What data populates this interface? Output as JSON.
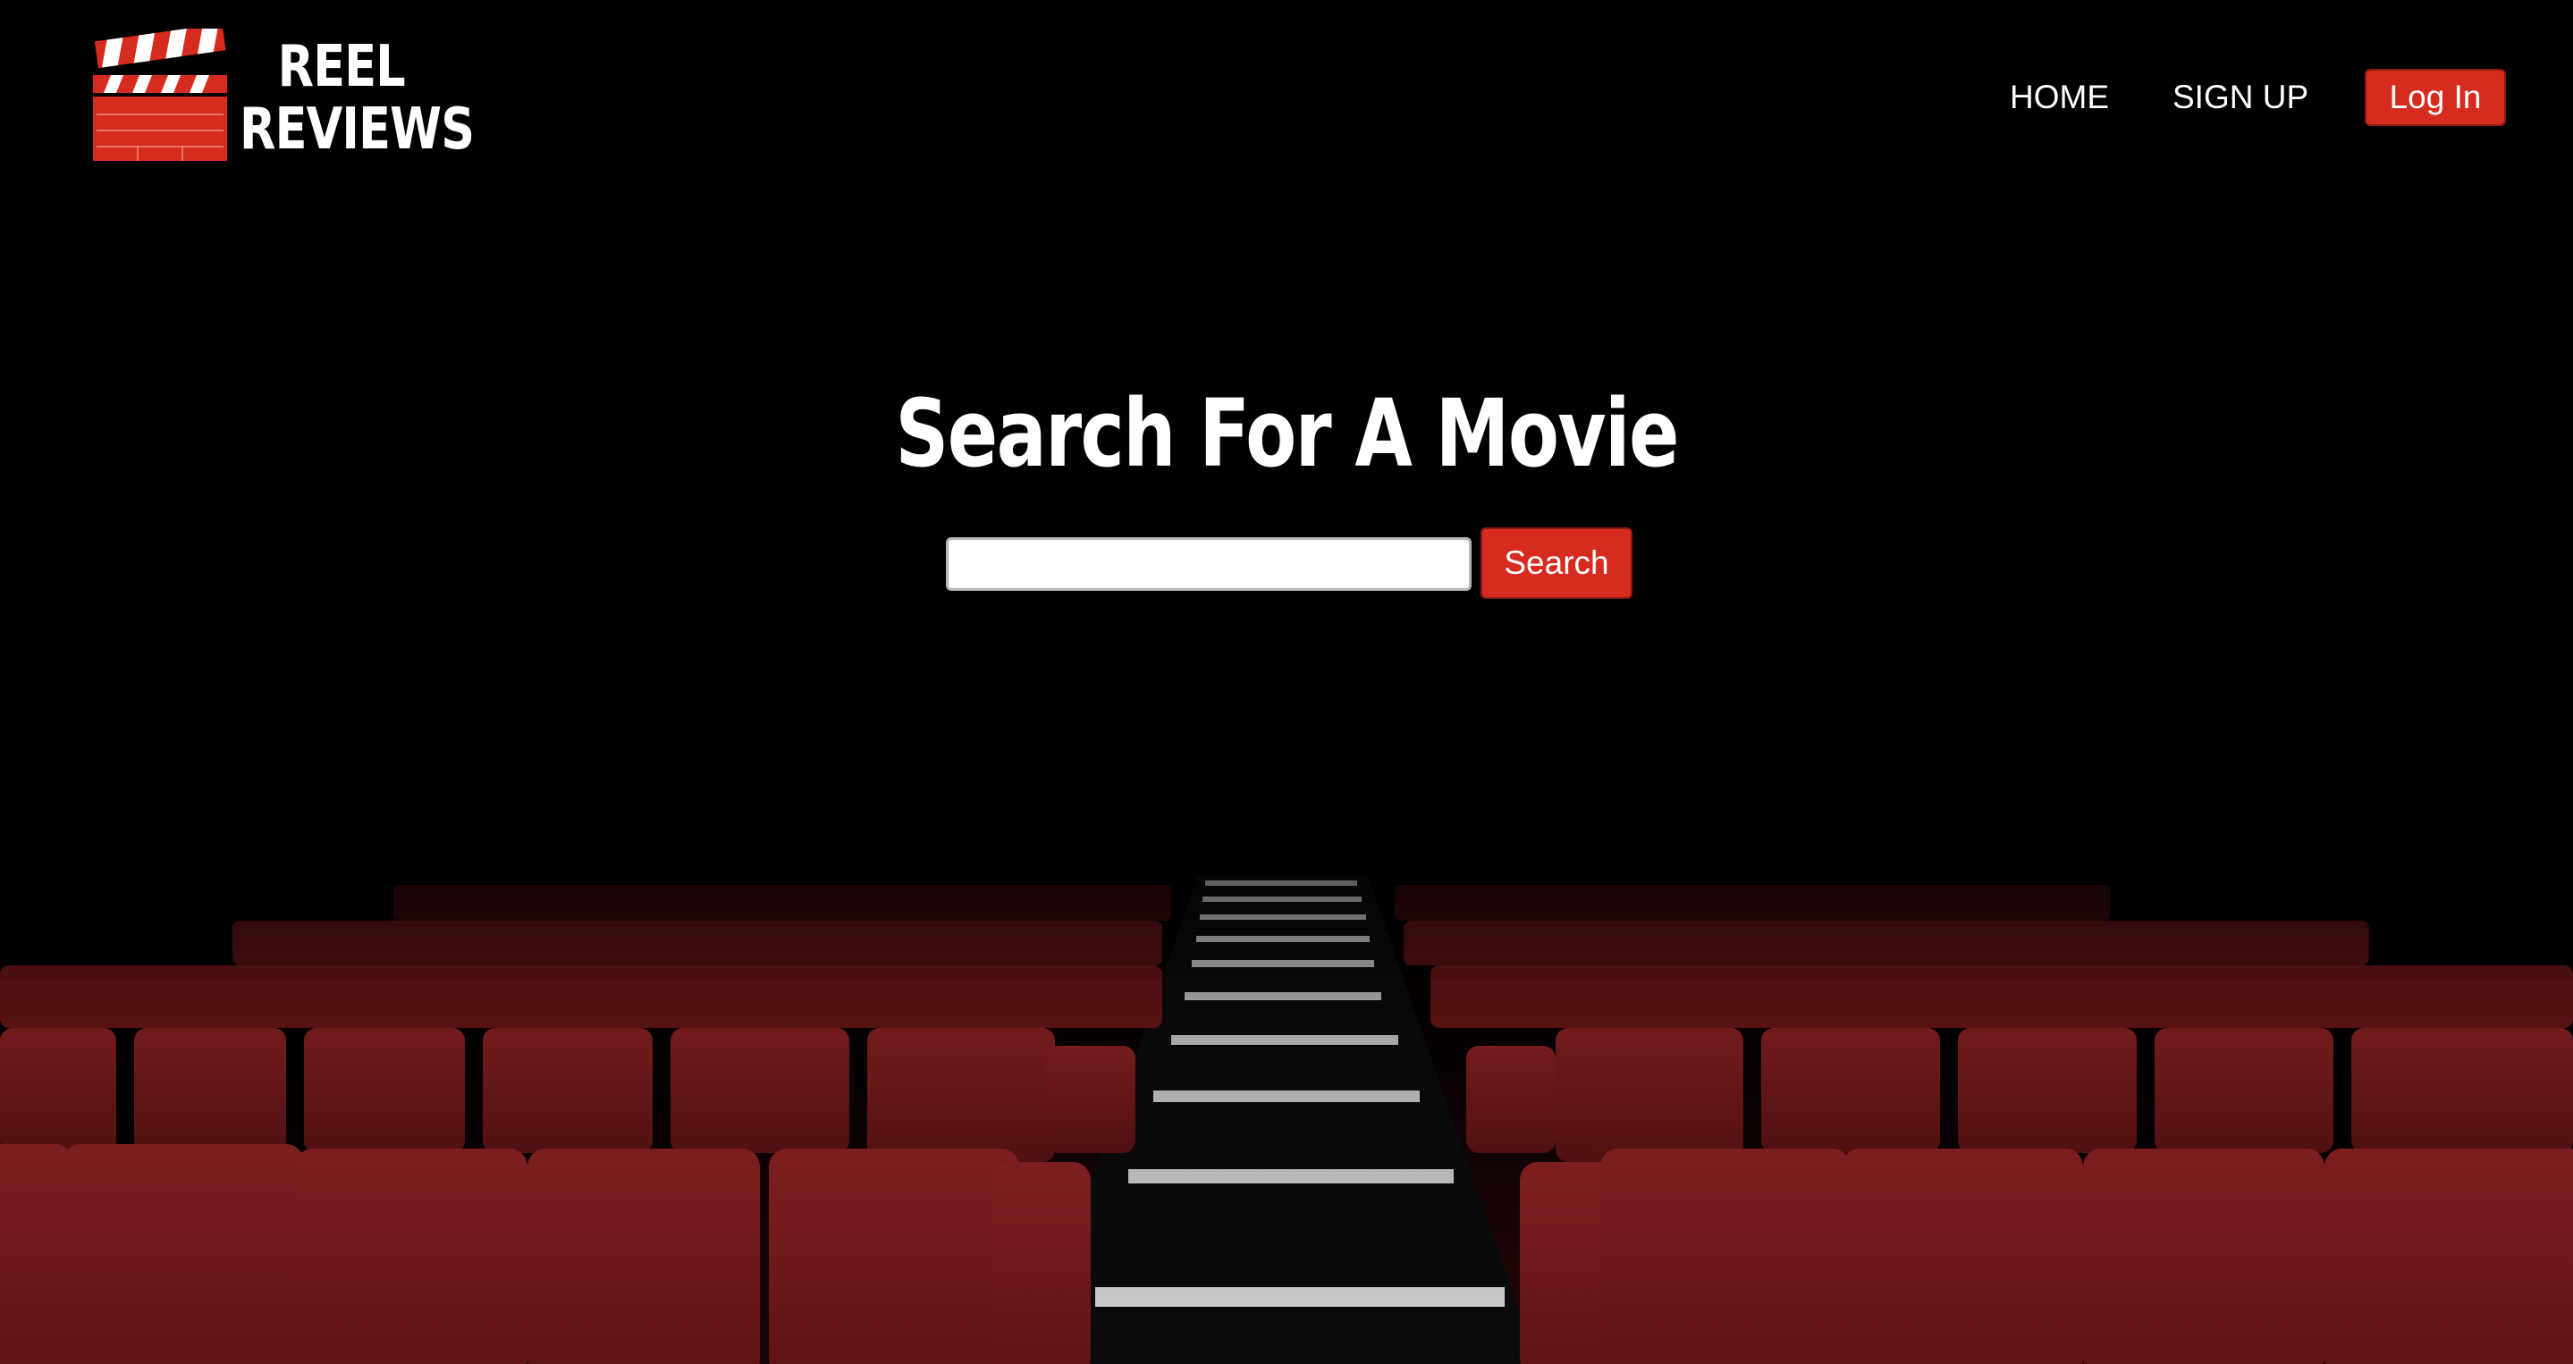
{
  "brand": {
    "line1": "REEL",
    "line2": "REVIEWS",
    "logo_icon": "clapperboard-icon"
  },
  "nav": {
    "home_label": "HOME",
    "signup_label": "SIGN UP",
    "login_label": "Log In"
  },
  "hero": {
    "title": "Search For A Movie",
    "search_value": "",
    "search_button_label": "Search"
  },
  "colors": {
    "background": "#000000",
    "accent": "#d62b1f",
    "seat": "#7a1a1c",
    "text": "#ffffff"
  }
}
